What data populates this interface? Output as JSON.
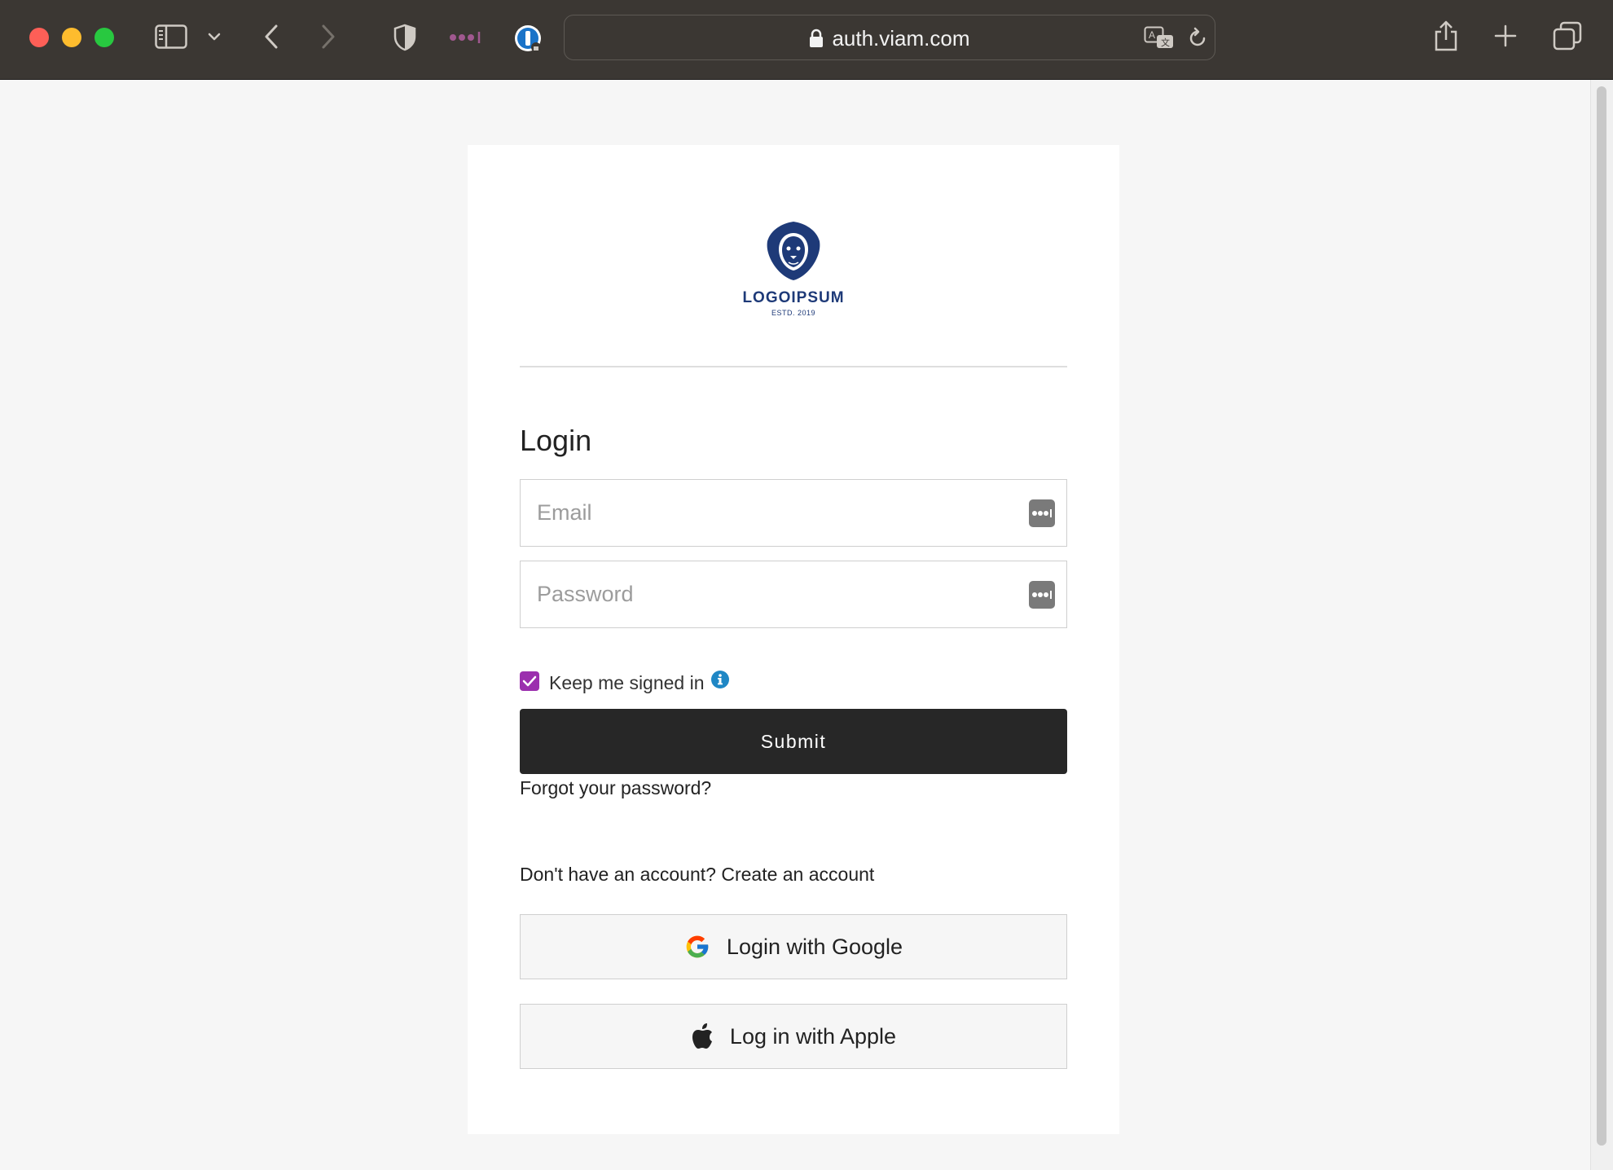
{
  "browser": {
    "url": "auth.viam.com"
  },
  "card": {
    "logo_wordmark": "LOGOIPSUM",
    "logo_established": "ESTD. 2019",
    "title": "Login",
    "email_placeholder": "Email",
    "password_placeholder": "Password",
    "keep_signed_in_label": "Keep me signed in",
    "keep_signed_in_checked": true,
    "submit_label": "Submit",
    "forgot_password_label": "Forgot your password?",
    "signup_prompt": "Don't have an account?",
    "create_account_label": "Create an account",
    "google_button_label": "Login with Google",
    "apple_button_label": "Log in with Apple"
  },
  "colors": {
    "toolbar_bg": "#3b3733",
    "page_bg": "#f6f6f6",
    "submit_bg": "#272727",
    "checkbox_accent": "#9b2fae",
    "info_icon": "#1f87c5",
    "logo_blue": "#1e3a78"
  },
  "icons": {
    "toolbar": [
      "sidebar-icon",
      "chevron-down-icon",
      "back-icon",
      "forward-icon",
      "shield-icon",
      "password-manager-icon",
      "onepassword-icon",
      "translate-icon",
      "reload-icon",
      "share-icon",
      "new-tab-icon",
      "tab-overview-icon"
    ],
    "fields": "password-manager-icon",
    "social": [
      "google-icon",
      "apple-icon"
    ]
  }
}
